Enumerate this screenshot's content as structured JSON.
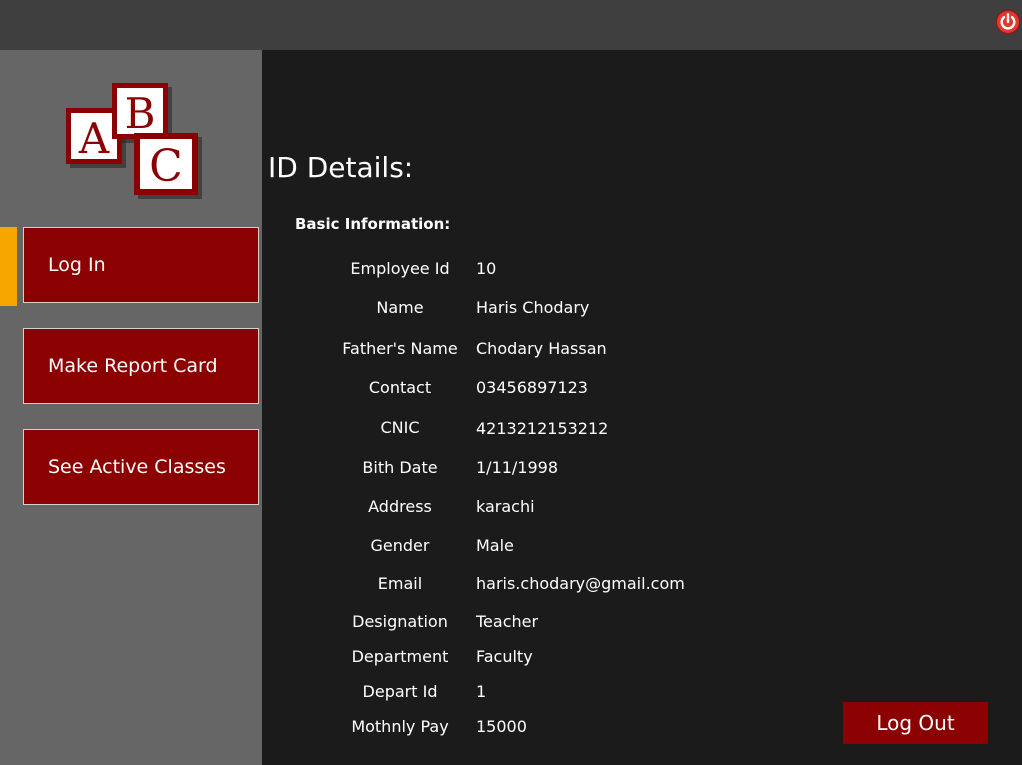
{
  "header": {
    "power_icon": "power-icon"
  },
  "logo": {
    "letters": [
      "A",
      "B",
      "C"
    ],
    "block_color": "#8b0000"
  },
  "sidebar": {
    "items": [
      {
        "label": "Log In",
        "active": true
      },
      {
        "label": "Make Report Card"
      },
      {
        "label": "See Active Classes"
      }
    ],
    "active_indicator_color": "#f7a600"
  },
  "main": {
    "title": "ID Details:",
    "section_title": "Basic Information:",
    "fields": [
      {
        "label": "Employee Id",
        "value": "10"
      },
      {
        "label": "Name",
        "value": "Haris Chodary"
      },
      {
        "label": "Father's Name",
        "value": "Chodary Hassan"
      },
      {
        "label": "Contact",
        "value": "03456897123"
      },
      {
        "label": "CNIC",
        "value": "4213212153212"
      },
      {
        "label": "Bith Date",
        "value": "1/11/1998"
      },
      {
        "label": "Address",
        "value": "karachi"
      },
      {
        "label": "Gender",
        "value": "Male"
      },
      {
        "label": "Email",
        "value": "haris.chodary@gmail.com"
      },
      {
        "label": "Designation",
        "value": "Teacher"
      },
      {
        "label": "Department",
        "value": "Faculty"
      },
      {
        "label": "Depart Id",
        "value": "1"
      },
      {
        "label": "Mothnly Pay",
        "value": "15000"
      }
    ],
    "logout_label": "Log Out"
  },
  "colors": {
    "accent": "#8b0000",
    "sidebar": "#666666",
    "background": "#1b1b1b"
  }
}
